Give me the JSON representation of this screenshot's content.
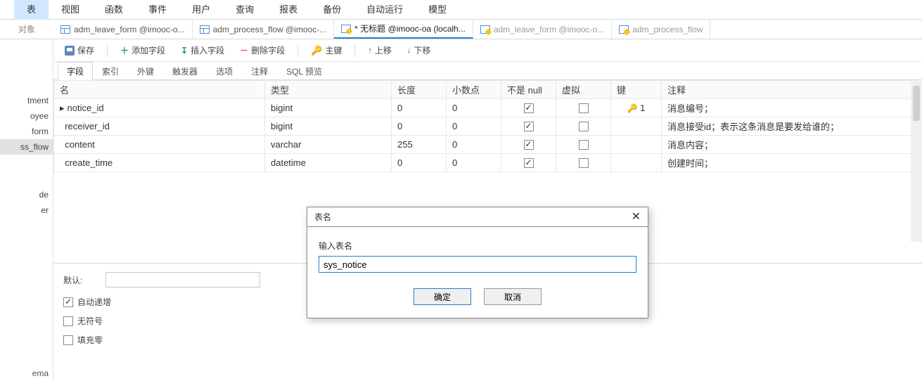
{
  "menu": {
    "items": [
      "表",
      "视图",
      "函数",
      "事件",
      "用户",
      "查询",
      "报表",
      "备份",
      "自动运行",
      "模型"
    ],
    "active_index": 0
  },
  "tabs": {
    "object_label": "对象",
    "items": [
      {
        "label": "adm_leave_form @imooc-o...",
        "kind": "table",
        "dim": false
      },
      {
        "label": "adm_process_flow @imooc-...",
        "kind": "table",
        "dim": false
      },
      {
        "label": "* 无标题 @imooc-oa (localh...",
        "kind": "design",
        "active": true
      },
      {
        "label": "adm_leave_form @imooc-o...",
        "kind": "design",
        "dim": true
      },
      {
        "label": "adm_process_flow",
        "kind": "design",
        "dim": true
      }
    ]
  },
  "toolbar": {
    "save": "保存",
    "add_field": "添加字段",
    "insert_field": "插入字段",
    "delete_field": "删除字段",
    "primary_key": "主键",
    "move_up": "上移",
    "move_down": "下移"
  },
  "subtabs": {
    "items": [
      "字段",
      "索引",
      "外键",
      "触发器",
      "选项",
      "注释",
      "SQL 预览"
    ],
    "active_index": 0
  },
  "grid": {
    "headers": {
      "name": "名",
      "type": "类型",
      "length": "长度",
      "decimals": "小数点",
      "not_null": "不是 null",
      "virtual": "虚拟",
      "key": "键",
      "comment": "注释"
    },
    "rows": [
      {
        "pointer": true,
        "name": "notice_id",
        "type": "bigint",
        "length": "0",
        "decimals": "0",
        "not_null": true,
        "virtual": false,
        "key": "1",
        "comment": "消息编号；"
      },
      {
        "name": "receiver_id",
        "type": "bigint",
        "length": "0",
        "decimals": "0",
        "not_null": true,
        "virtual": false,
        "key": "",
        "comment": "消息接受id；表示这条消息是要发给谁的；"
      },
      {
        "name": "content",
        "type": "varchar",
        "length": "255",
        "decimals": "0",
        "not_null": true,
        "virtual": false,
        "key": "",
        "comment": "消息内容；"
      },
      {
        "name": "create_time",
        "type": "datetime",
        "length": "0",
        "decimals": "0",
        "not_null": true,
        "virtual": false,
        "key": "",
        "comment": "创建时间；"
      }
    ]
  },
  "props": {
    "default_label": "默认:",
    "default_value": "",
    "auto_inc": {
      "label": "自动递增",
      "checked": true
    },
    "unsigned": {
      "label": "无符号",
      "checked": false
    },
    "zerofill": {
      "label": "填充零",
      "checked": false
    }
  },
  "sidebar": {
    "items": [
      {
        "label": "tment"
      },
      {
        "label": "oyee"
      },
      {
        "label": "form"
      },
      {
        "label": "ss_flow",
        "selected": true
      },
      {
        "label": ""
      },
      {
        "label": ""
      },
      {
        "label": "de"
      },
      {
        "label": "er"
      }
    ],
    "bottom_label": "ema"
  },
  "dialog": {
    "title": "表名",
    "prompt": "输入表名",
    "value": "sys_notice",
    "ok": "确定",
    "cancel": "取消"
  }
}
